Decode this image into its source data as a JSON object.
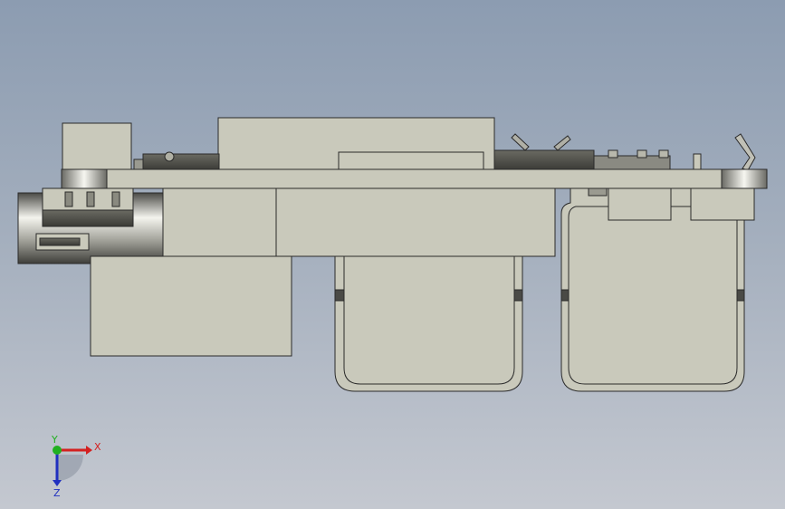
{
  "viewport": {
    "colors": {
      "background_top": "#8c9cb1",
      "background_bottom": "#c4c8d0",
      "part_fill": "#c9c9bb",
      "part_edge": "#2a2a2a"
    }
  },
  "triad": {
    "x_label": "X",
    "y_label": "Y",
    "z_label": "Z",
    "colors": {
      "x": "#d42020",
      "y": "#20b020",
      "z": "#2030c0"
    }
  }
}
